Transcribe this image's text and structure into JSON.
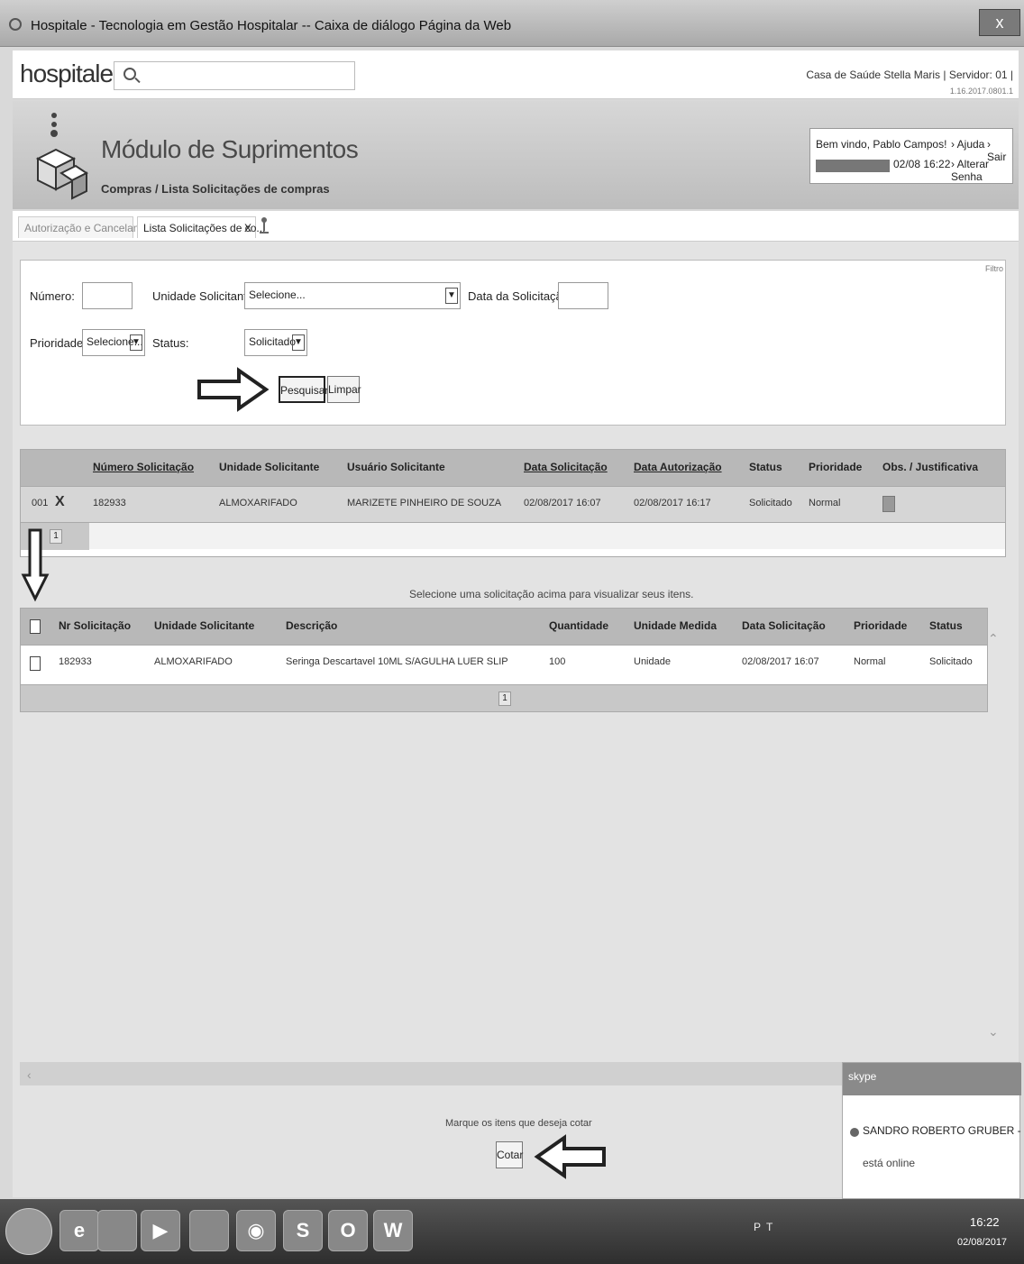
{
  "window": {
    "title": "Hospitale - Tecnologia em Gestão Hospitalar -- Caixa de diálogo Página da Web",
    "close": "x"
  },
  "header": {
    "logo": "hospitale",
    "org_server": "Casa de Saúde Stella Maris | Servidor: 01 |",
    "version": "1.16.2017.0801.1"
  },
  "module": {
    "title": "Módulo de Suprimentos",
    "breadcrumb": "Compras / Lista Solicitações de compras"
  },
  "user": {
    "welcome": "Bem vindo, Pablo Campos!",
    "datetime": "02/08 16:22",
    "help": "› Ajuda",
    "logout": "› Sair",
    "change_password": "› Alterar Senha"
  },
  "tabs": [
    {
      "label": "Autorização e Cancelamen..."
    },
    {
      "label": "Lista Solicitações de co...",
      "close": "X"
    }
  ],
  "filters": {
    "corner_label": "Filtro",
    "numero_label": "Número:",
    "numero_value": "",
    "unidade_label": "Unidade Solicitante:",
    "unidade_value": "Selecione...",
    "data_label": "Data da Solicitação:",
    "data_value": "",
    "prioridade_label": "Prioridade:",
    "prioridade_value": "Selecione...",
    "status_label": "Status:",
    "status_value": "Solicitado",
    "search_button": "Pesquisar",
    "clear_button": "Limpar"
  },
  "requests_table": {
    "columns": [
      "Número Solicitação",
      "Unidade Solicitante",
      "Usuário Solicitante",
      "Data Solicitação",
      "Data Autorização",
      "Status",
      "Prioridade",
      "Obs. / Justificativa"
    ],
    "rows": [
      {
        "index": "001",
        "delete": "X",
        "numero": "182933",
        "unidade": "ALMOXARIFADO",
        "usuario": "MARIZETE PINHEIRO DE SOUZA",
        "data_solicitacao": "02/08/2017 16:07",
        "data_autorizacao": "02/08/2017 16:17",
        "status": "Solicitado",
        "prioridade": "Normal"
      }
    ],
    "page": "1"
  },
  "items_hint": "Selecione uma solicitação acima para visualizar seus itens.",
  "items_table": {
    "columns": [
      "Nr Solicitação",
      "Unidade Solicitante",
      "Descrição",
      "Quantidade",
      "Unidade Medida",
      "Data Solicitação",
      "Prioridade",
      "Status"
    ],
    "rows": [
      {
        "nr": "182933",
        "unidade": "ALMOXARIFADO",
        "descricao": "Seringa Descartavel 10ML S/AGULHA LUER SLIP",
        "quantidade": "100",
        "unidade_medida": "Unidade",
        "data": "02/08/2017 16:07",
        "prioridade": "Normal",
        "status": "Solicitado"
      }
    ],
    "page": "1"
  },
  "footer": {
    "hint": "Marque os itens que deseja cotar",
    "quote_button": "Cotar"
  },
  "skype": {
    "logo": "skype",
    "name": "SANDRO ROBERTO GRUBER - G...",
    "message": "está online"
  },
  "taskbar": {
    "tray": "PT",
    "time": "16:22",
    "date": "02/08/2017",
    "apps": [
      "ie-icon",
      "files-icon",
      "media-icon",
      "folder-icon",
      "chrome-icon",
      "skype-icon",
      "outlook-icon",
      "word-icon"
    ]
  },
  "colors": {
    "header_bg": "#b8b8b8",
    "row_bg": "#d6d6d6",
    "panel_bg": "#ffffff"
  }
}
